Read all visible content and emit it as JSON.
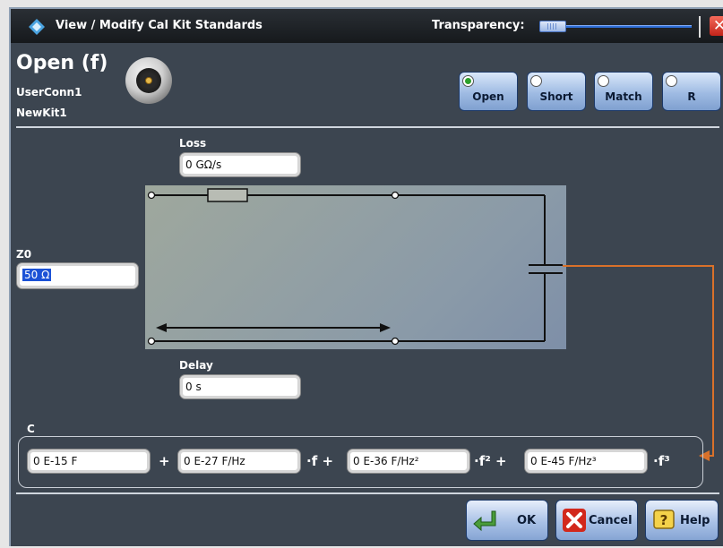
{
  "window": {
    "title": "View / Modify Cal Kit Standards",
    "transparency_label": "Transparency:",
    "close_symbol": "✕"
  },
  "standard": {
    "name": "Open (f)",
    "connector": "UserConn1",
    "kit": "NewKit1"
  },
  "standard_types": [
    {
      "label": "Open",
      "selected": true
    },
    {
      "label": "Short",
      "selected": false
    },
    {
      "label": "Match",
      "selected": false
    },
    {
      "label": "R",
      "selected": false
    }
  ],
  "fields": {
    "loss": {
      "label": "Loss",
      "value": "0 GΩ/s"
    },
    "z0": {
      "label": "Z0",
      "value": "50 Ω"
    },
    "delay": {
      "label": "Delay",
      "value": "0 s"
    },
    "c": {
      "label": "C",
      "c0": "0 E-15 F",
      "c1": "0 E-27 F/Hz",
      "c2": "0 E-36 F/Hz²",
      "c3": "0 E-45 F/Hz³",
      "op1": "+",
      "op2": "·f +",
      "op3": "·f² +",
      "op4": "·f³"
    }
  },
  "buttons": {
    "ok": "OK",
    "cancel": "Cancel",
    "help": "Help"
  },
  "colors": {
    "accent": "#2f6fd8",
    "capacitor_link": "#d9712a",
    "background": "#3c4550"
  },
  "icons": [
    "rohde-schwarz-logo-icon",
    "close-icon",
    "ok-arrow-icon",
    "cancel-x-icon",
    "help-question-icon"
  ]
}
